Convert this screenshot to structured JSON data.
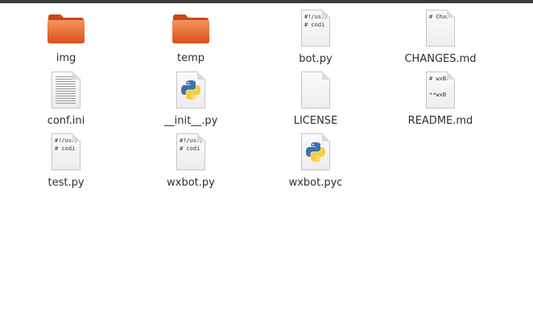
{
  "files": [
    {
      "name": "img",
      "type": "folder",
      "icon": "folder-icon"
    },
    {
      "name": "temp",
      "type": "folder",
      "icon": "folder-icon"
    },
    {
      "name": "bot.py",
      "type": "text",
      "icon": "text-file-icon",
      "preview": [
        "#!/usr/",
        "# codi"
      ]
    },
    {
      "name": "CHANGES.md",
      "type": "text",
      "icon": "text-file-icon",
      "preview": [
        "# Char"
      ]
    },
    {
      "name": "conf.ini",
      "type": "lines",
      "icon": "text-file-icon"
    },
    {
      "name": "__init__.py",
      "type": "python",
      "icon": "python-icon"
    },
    {
      "name": "LICENSE",
      "type": "blank",
      "icon": "document-icon"
    },
    {
      "name": "README.md",
      "type": "text",
      "icon": "text-file-icon",
      "preview": [
        "# wxBr",
        "",
        "**wxB"
      ]
    },
    {
      "name": "test.py",
      "type": "text",
      "icon": "text-file-icon",
      "preview": [
        "#!/usr/",
        "# codi"
      ]
    },
    {
      "name": "wxbot.py",
      "type": "text",
      "icon": "text-file-icon",
      "preview": [
        "#!/usr/",
        "# codi"
      ]
    },
    {
      "name": "wxbot.pyc",
      "type": "python",
      "icon": "python-icon"
    }
  ],
  "colors": {
    "folder_top": "#f48a52",
    "folder_bottom": "#d9501c",
    "python_blue": "#3b73a8",
    "python_yellow": "#f7cf3f",
    "titlebar": "#3c3b37"
  }
}
